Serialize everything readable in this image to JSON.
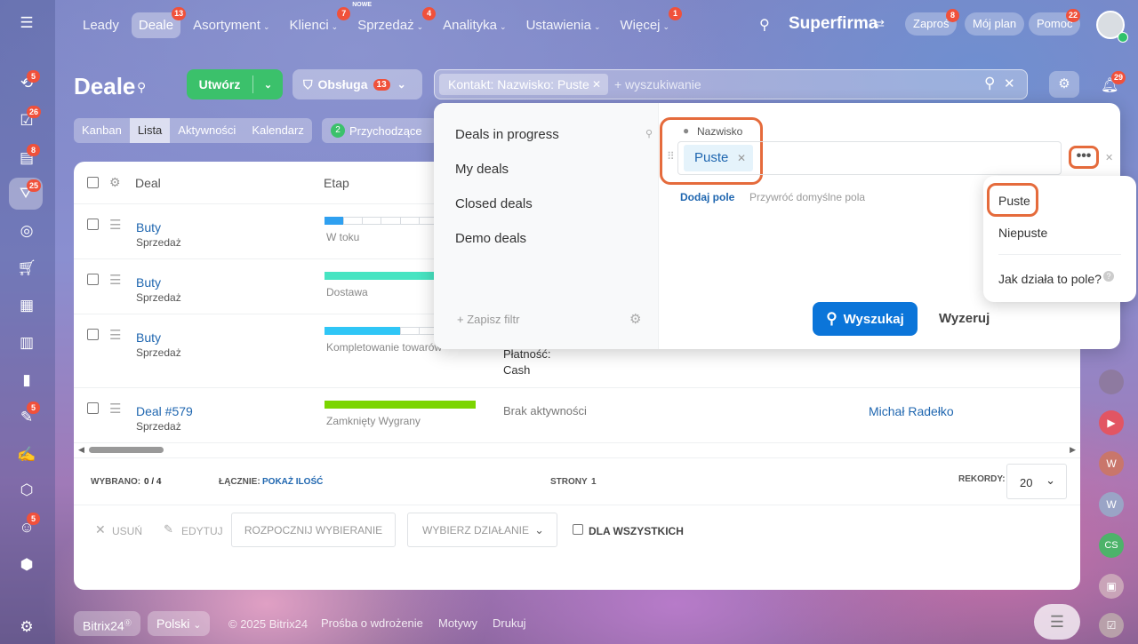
{
  "topnav": {
    "items": [
      {
        "label": "Leady",
        "badge": "",
        "chevron": false,
        "active": false
      },
      {
        "label": "Deale",
        "badge": "13",
        "chevron": false,
        "active": true
      },
      {
        "label": "Asortyment",
        "badge": "",
        "chevron": true,
        "active": false
      },
      {
        "label": "Klienci",
        "badge": "7",
        "chevron": true,
        "active": false
      },
      {
        "label": "Sprzedaż",
        "badge": "4",
        "chevron": true,
        "active": false,
        "new_label": "NOWE"
      },
      {
        "label": "Analityka",
        "badge": "",
        "chevron": true,
        "active": false
      },
      {
        "label": "Ustawienia",
        "badge": "",
        "chevron": true,
        "active": false
      },
      {
        "label": "Więcej",
        "badge": "1",
        "chevron": true,
        "active": false
      }
    ],
    "company": "Superfirma",
    "invite": "Zaproś",
    "invite_badge": "8",
    "plan": "Mój plan",
    "help": "Pomoc",
    "help_badge": "22"
  },
  "sidebar": {
    "badges": {
      "b1": "5",
      "b2": "26",
      "b3": "8",
      "b4": "25",
      "b5": "5",
      "b6": "5"
    }
  },
  "header": {
    "title": "Deale",
    "create_label": "Utwórz",
    "service_label": "Obsługa",
    "service_badge": "13",
    "filter_chip": "Kontakt: Nazwisko: Puste",
    "search_placeholder": "+ wyszukiwanie",
    "bell_badge": "29"
  },
  "view_tabs": [
    "Kanban",
    "Lista",
    "Aktywności",
    "Kalendarz"
  ],
  "incoming": {
    "count": "2",
    "label": "Przychodzące"
  },
  "table": {
    "headers": {
      "deal": "Deal",
      "stage": "Etap"
    },
    "rows": [
      {
        "title": "Buty",
        "sub": "Sprzedaż",
        "stage": "W toku",
        "color": "#2fa0f0",
        "fill": 0.125,
        "activity": "",
        "person": ""
      },
      {
        "title": "Buty",
        "sub": "Sprzedaż",
        "stage": "Dostawa",
        "color": "#47e4c2",
        "fill": 0.7,
        "activity": "",
        "person": ""
      },
      {
        "title": "Buty",
        "sub": "Sprzedaż",
        "stage": "Kompletowanie towarów",
        "color": "#2fc6f6",
        "fill": 0.5,
        "activity": "Płatność:",
        "activity2": "Cash",
        "person": ""
      },
      {
        "title": "Deal #579",
        "sub": "Sprzedaż",
        "stage": "Zamknięty Wygrany",
        "color": "#7bd500",
        "fill": 1,
        "activity": "Brak aktywności",
        "person": "Michał Radełko"
      }
    ]
  },
  "summary": {
    "selected_label": "WYBRANO:",
    "selected": "0 / 4",
    "total_label": "ŁĄCZNIE:",
    "total_link": "POKAŻ ILOŚĆ",
    "pages_label": "STRONY",
    "pages": "1",
    "records_label": "REKORDY:",
    "records": "20"
  },
  "actions": {
    "delete": "USUŃ",
    "edit": "EDYTUJ",
    "start": "ROZPOCZNIJ WYBIERANIE",
    "choose": "WYBIERZ DZIAŁANIE",
    "all": "DLA WSZYSTKICH"
  },
  "filter_panel": {
    "presets": [
      "Deals in progress",
      "My deals",
      "Closed deals",
      "Demo deals"
    ],
    "save": "+ Zapisz filtr",
    "field_label": "Nazwisko",
    "field_value": "Puste",
    "add_field": "Dodaj pole",
    "restore": "Przywróć domyślne pola",
    "search": "Wyszukaj",
    "reset": "Wyzeruj"
  },
  "dropdown": {
    "items": [
      "Puste",
      "Niepuste"
    ],
    "help": "Jak działa to pole?"
  },
  "footer": {
    "brand": "Bitrix24",
    "lang": "Polski",
    "copyright": "© 2025 Bitrix24",
    "links": [
      "Prośba o wdrożenie",
      "Motywy",
      "Drukuj"
    ]
  }
}
